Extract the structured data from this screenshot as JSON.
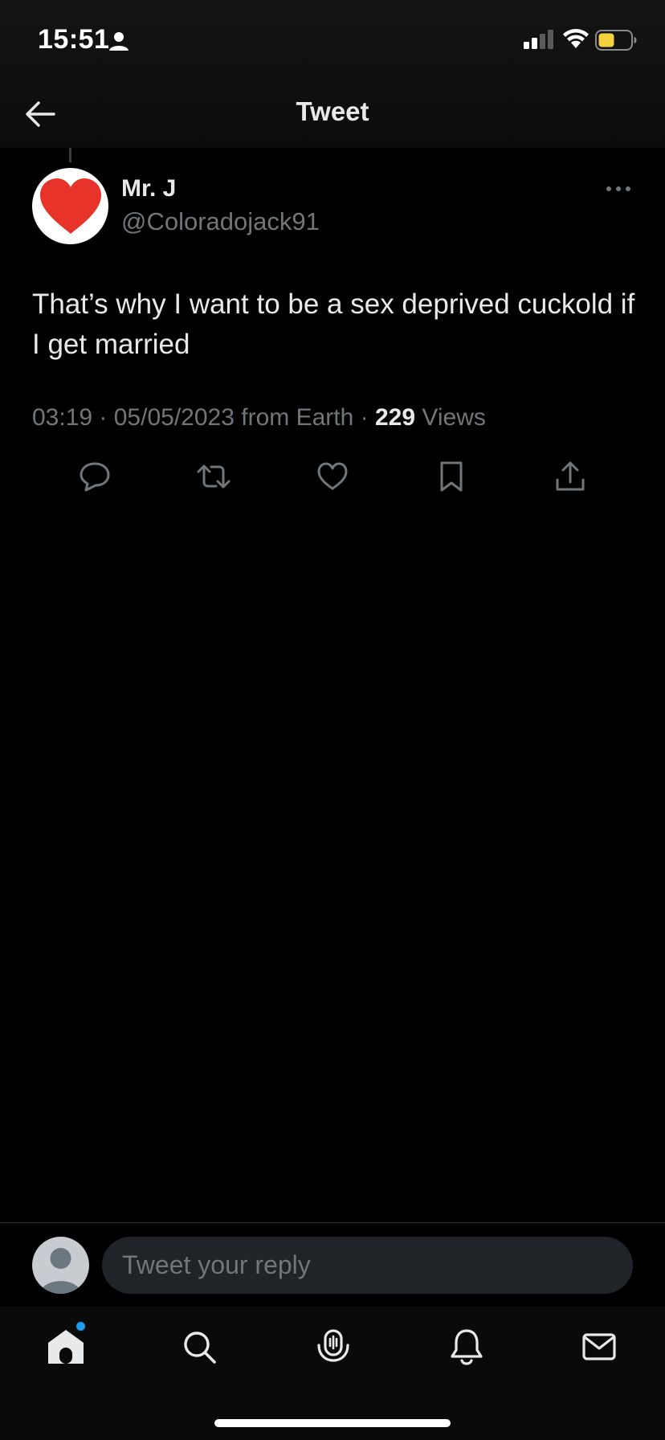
{
  "status_bar": {
    "time": "15:51",
    "icons": [
      "person-icon",
      "cellular-signal-icon",
      "wifi-icon",
      "battery-icon"
    ],
    "battery_color": "#f4d03f"
  },
  "nav": {
    "back_icon": "arrow-left-icon",
    "title": "Tweet"
  },
  "tweet": {
    "author": {
      "display_name": "Mr. J",
      "handle": "@Coloradojack91",
      "avatar": "red-heart-icon"
    },
    "more_icon": "more-horizontal-icon",
    "text": "That’s why I want to be a sex deprived cuckold if I get married",
    "meta": {
      "time": "03:19",
      "separator": " · ",
      "date": "05/05/2023",
      "source": "from Earth",
      "views_count": "229",
      "views_label": "Views"
    },
    "actions": [
      "reply-icon",
      "retweet-icon",
      "like-icon",
      "bookmark-icon",
      "share-icon"
    ]
  },
  "reply": {
    "placeholder": "Tweet your reply",
    "avatar": "default-avatar-icon"
  },
  "tab_bar": {
    "items": [
      "home-icon",
      "search-icon",
      "spaces-icon",
      "notifications-icon",
      "messages-icon"
    ],
    "active": "home-icon",
    "notification_dot_color": "#1d9bf0"
  },
  "colors": {
    "background": "#000000",
    "primary_text": "#e7e9ea",
    "secondary_text": "#71767b",
    "accent": "#1d9bf0",
    "heart_red": "#e8332a"
  }
}
